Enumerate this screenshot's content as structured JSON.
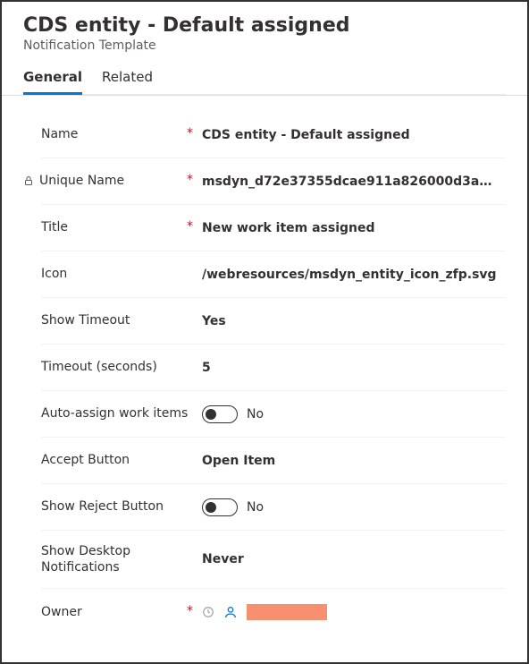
{
  "header": {
    "title": "CDS entity - Default assigned",
    "subtitle": "Notification Template"
  },
  "tabs": {
    "general": "General",
    "related": "Related"
  },
  "fields": {
    "name": {
      "label": "Name",
      "value": "CDS entity - Default assigned"
    },
    "uniqueName": {
      "label": "Unique Name",
      "value": "msdyn_d72e37355dcae911a826000d3a…"
    },
    "title": {
      "label": "Title",
      "value": "New work item assigned"
    },
    "icon": {
      "label": "Icon",
      "value": "/webresources/msdyn_entity_icon_zfp.svg"
    },
    "showTimeout": {
      "label": "Show Timeout",
      "value": "Yes"
    },
    "timeout": {
      "label": "Timeout (seconds)",
      "value": "5"
    },
    "autoAssign": {
      "label": "Auto-assign work items",
      "toggleText": "No"
    },
    "acceptButton": {
      "label": "Accept Button",
      "value": "Open Item"
    },
    "showReject": {
      "label": "Show Reject Button",
      "toggleText": "No"
    },
    "showDesktop": {
      "label": "Show Desktop Notifications",
      "value": "Never"
    },
    "owner": {
      "label": "Owner"
    }
  },
  "requiredMark": "*"
}
